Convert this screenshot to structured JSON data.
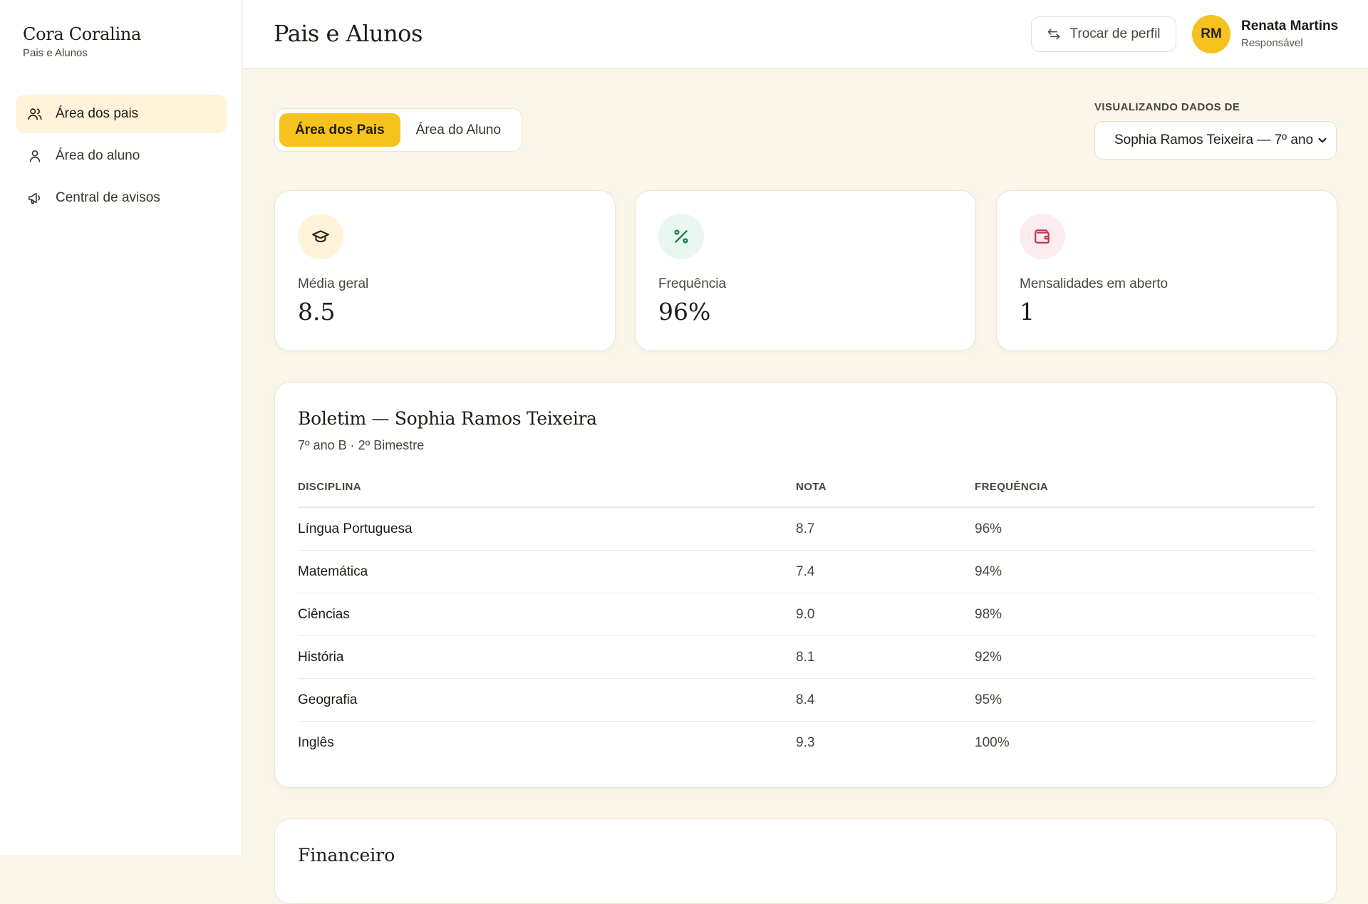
{
  "brand": {
    "title": "Cora Coralina",
    "subtitle": "Pais e Alunos"
  },
  "sidebar": {
    "items": [
      {
        "label": "Área dos pais",
        "icon": "users-icon",
        "active": true
      },
      {
        "label": "Área do aluno",
        "icon": "user-icon",
        "active": false
      },
      {
        "label": "Central de avisos",
        "icon": "megaphone-icon",
        "active": false
      }
    ]
  },
  "header": {
    "title": "Pais e Alunos",
    "switch_profile_label": "Trocar de perfil",
    "user": {
      "initials": "RM",
      "name": "Renata Martins",
      "role": "Responsável"
    }
  },
  "tabs": [
    {
      "label": "Área dos Pais",
      "active": true
    },
    {
      "label": "Área do Aluno",
      "active": false
    }
  ],
  "viewing": {
    "label": "VISUALIZANDO DADOS DE",
    "selected": "Sophia Ramos Teixeira — 7º ano"
  },
  "stats": [
    {
      "label": "Média geral",
      "value": "8.5",
      "icon": "graduation-cap-icon",
      "icon_bg": "#fff4d9",
      "icon_color": "#2a2418"
    },
    {
      "label": "Frequência",
      "value": "96%",
      "icon": "percent-icon",
      "icon_bg": "#e8f7f0",
      "icon_color": "#1f7a55"
    },
    {
      "label": "Mensalidades em aberto",
      "value": "1",
      "icon": "wallet-icon",
      "icon_bg": "#fdecef",
      "icon_color": "#c2324f"
    }
  ],
  "report": {
    "title": "Boletim — Sophia Ramos Teixeira",
    "subtitle": "7º ano B · 2º Bimestre",
    "columns": [
      "DISCIPLINA",
      "NOTA",
      "FREQUÊNCIA"
    ],
    "rows": [
      [
        "Língua Portuguesa",
        "8.7",
        "96%"
      ],
      [
        "Matemática",
        "7.4",
        "94%"
      ],
      [
        "Ciências",
        "9.0",
        "98%"
      ],
      [
        "História",
        "8.1",
        "92%"
      ],
      [
        "Geografia",
        "8.4",
        "95%"
      ],
      [
        "Inglês",
        "9.3",
        "100%"
      ]
    ]
  },
  "finance": {
    "title": "Financeiro"
  },
  "colors": {
    "accent": "#f7c11e",
    "background": "#faf6ea",
    "active_nav": "#fff4d9"
  }
}
